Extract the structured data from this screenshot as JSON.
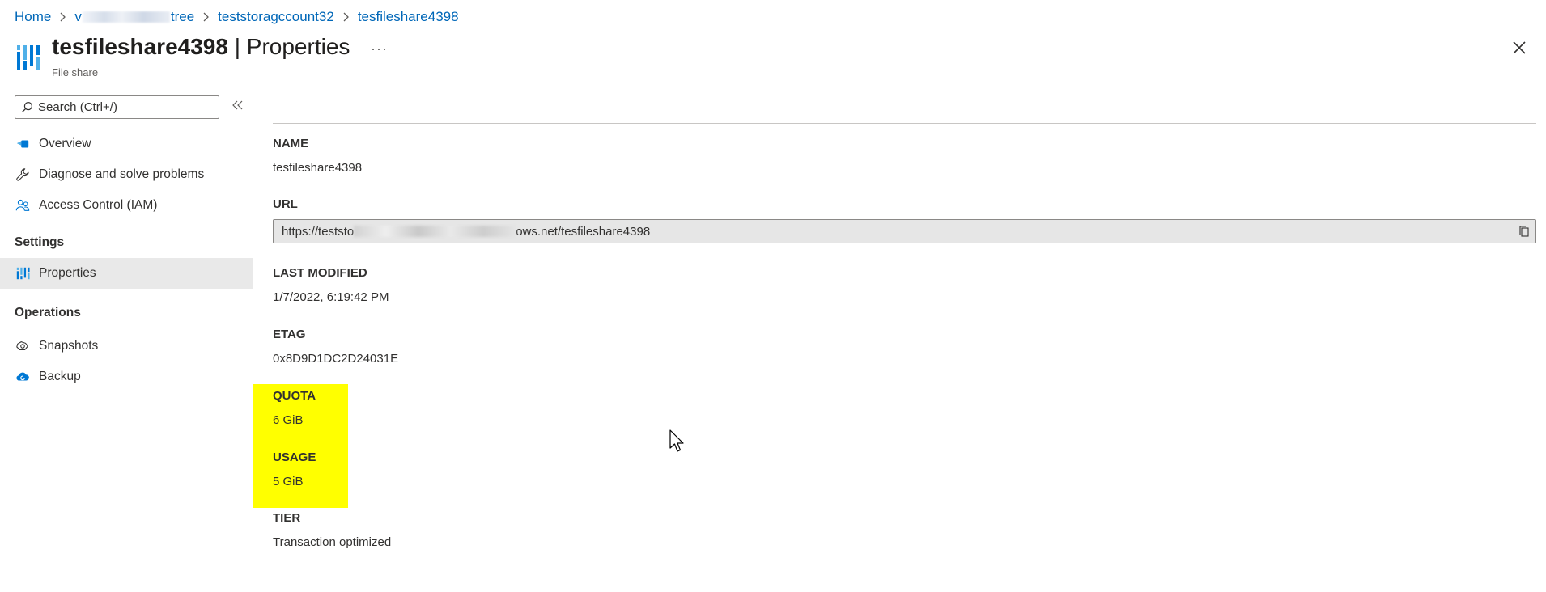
{
  "breadcrumb": {
    "items": [
      {
        "label": "Home"
      },
      {
        "prefix": "v",
        "suffix": "tree"
      },
      {
        "label": "teststoragccount32"
      },
      {
        "label": "tesfileshare4398"
      }
    ]
  },
  "header": {
    "resource_name": "tesfileshare4398",
    "separator": " | ",
    "blade_name": "Properties",
    "subtitle": "File share",
    "more_label": "···",
    "icon": "file-share-icon"
  },
  "sidebar": {
    "search_placeholder": "Search (Ctrl+/)",
    "items_top": [
      {
        "label": "Overview",
        "icon": "overview-icon"
      },
      {
        "label": "Diagnose and solve problems",
        "icon": "wrench-icon"
      },
      {
        "label": "Access Control (IAM)",
        "icon": "people-icon"
      }
    ],
    "section_settings": "Settings",
    "settings_items": [
      {
        "label": "Properties",
        "icon": "properties-icon",
        "selected": true
      }
    ],
    "section_operations": "Operations",
    "operations_items": [
      {
        "label": "Snapshots",
        "icon": "snapshots-icon"
      },
      {
        "label": "Backup",
        "icon": "backup-icon"
      }
    ]
  },
  "properties": {
    "name_label": "NAME",
    "name_value": "tesfileshare4398",
    "url_label": "URL",
    "url_prefix": "https://teststo",
    "url_suffix": "ows.net/tesfileshare4398",
    "last_modified_label": "LAST MODIFIED",
    "last_modified_value": "1/7/2022, 6:19:42 PM",
    "etag_label": "ETAG",
    "etag_value": "0x8D9D1DC2D24031E",
    "quota_label": "QUOTA",
    "quota_value": "6 GiB",
    "usage_label": "USAGE",
    "usage_value": "5 GiB",
    "tier_label": "TIER",
    "tier_value": "Transaction optimized"
  },
  "colors": {
    "link": "#0067b8",
    "highlight": "#ffff00",
    "selected_bg": "#e9e9e9",
    "azure_blue": "#0078d4"
  }
}
